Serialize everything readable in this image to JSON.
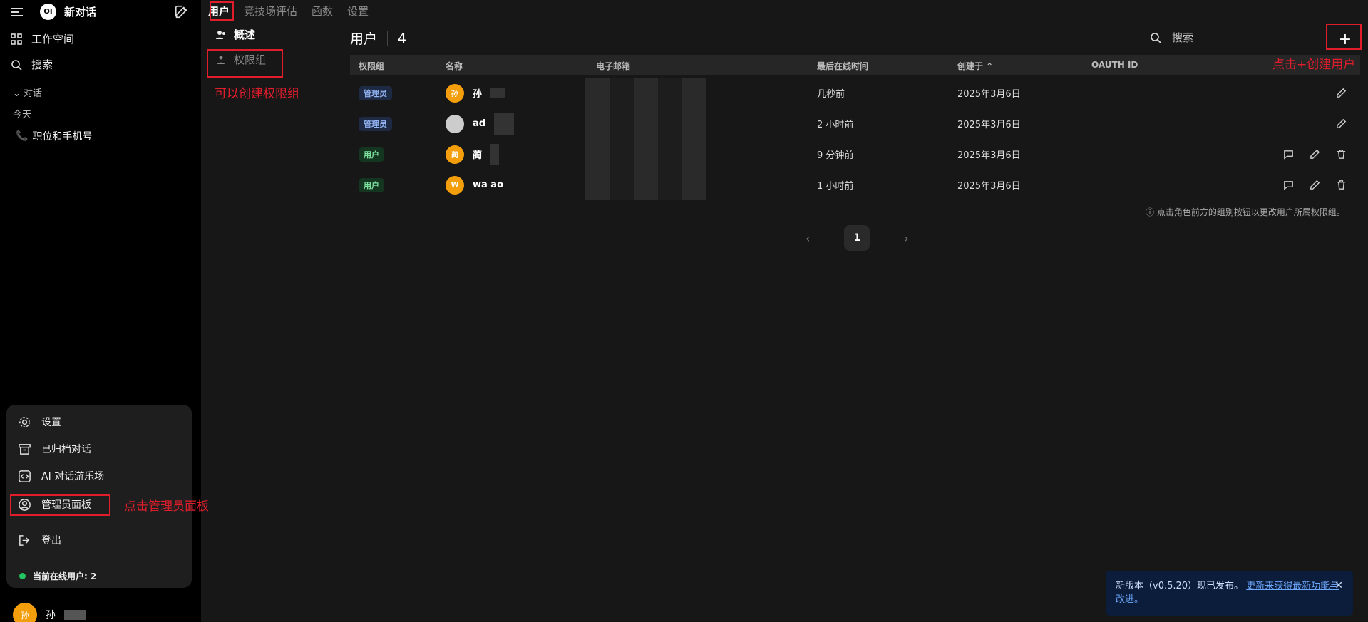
{
  "sidebar": {
    "new_chat": "新对话",
    "logo_text": "OI",
    "workspace": "工作空间",
    "search": "搜索",
    "section_chats": "对话",
    "section_today": "今天",
    "chat_item": "职位和手机号",
    "menu": {
      "settings": "设置",
      "archived": "已归档对话",
      "playground": "AI 对话游乐场",
      "admin": "管理员面板",
      "logout": "登出",
      "online": "当前在线用户: 2"
    },
    "user_name": "孙",
    "user_avatar": "孙"
  },
  "tabs": [
    "用户",
    "竞技场评估",
    "函数",
    "设置"
  ],
  "subnav": {
    "overview": "概述",
    "groups": "权限组"
  },
  "main": {
    "title": "用户",
    "count": "4",
    "search_placeholder": "搜索",
    "add_label": "+",
    "columns": [
      "权限组",
      "名称",
      "电子邮箱",
      "最后在线时间",
      "创建于 ⌃",
      "OAUTH ID"
    ],
    "rows": [
      {
        "role": "管理员",
        "name": "孙",
        "avatar": "孙",
        "last": "几秒前",
        "created": "2025年3月6日"
      },
      {
        "role": "管理员",
        "name": "ad",
        "avatar": "",
        "last": "2 小时前",
        "created": "2025年3月6日"
      },
      {
        "role": "用户",
        "name": "蔺",
        "avatar": "蔺",
        "last": "9 分钟前",
        "created": "2025年3月6日"
      },
      {
        "role": "用户",
        "name": "wa ao",
        "avatar": "W",
        "last": "1 小时前",
        "created": "2025年3月6日"
      }
    ],
    "hint": "ⓘ 点击角色前方的组别按钮以更改用户所属权限组。",
    "page": "1",
    "prev": "‹",
    "next": "›"
  },
  "toast": {
    "text": "新版本（v0.5.20）现已发布。",
    "link": "更新来获得最新功能与改进。",
    "close": "✕"
  },
  "annotations": {
    "create_group": "可以创建权限组",
    "create_user": "点击+创建用户",
    "admin_panel": "点击管理员面板"
  },
  "colors": {
    "annotation": "#e11d2c",
    "admin_badge": "#93b4f5",
    "user_badge": "#7ee2a0",
    "online": "#22c55e"
  }
}
